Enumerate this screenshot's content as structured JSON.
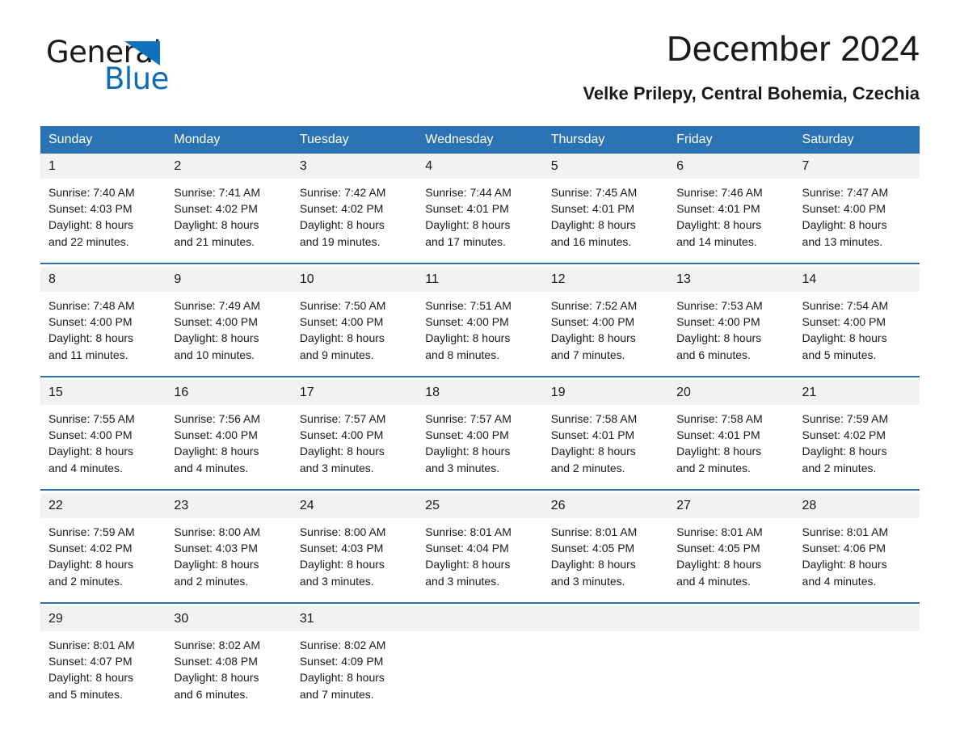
{
  "brand": {
    "name_part1": "General",
    "name_part2": "Blue",
    "triangle_color": "#1072ba",
    "blue_color": "#0d6cb4"
  },
  "header": {
    "title": "December 2024",
    "subtitle": "Velke Prilepy, Central Bohemia, Czechia",
    "accent_color": "#2b72b4",
    "daynum_bg": "#f2f2f2"
  },
  "weekdays": [
    "Sunday",
    "Monday",
    "Tuesday",
    "Wednesday",
    "Thursday",
    "Friday",
    "Saturday"
  ],
  "weeks": [
    [
      {
        "day": "1",
        "sunrise": "Sunrise: 7:40 AM",
        "sunset": "Sunset: 4:03 PM",
        "daylight1": "Daylight: 8 hours",
        "daylight2": "and 22 minutes."
      },
      {
        "day": "2",
        "sunrise": "Sunrise: 7:41 AM",
        "sunset": "Sunset: 4:02 PM",
        "daylight1": "Daylight: 8 hours",
        "daylight2": "and 21 minutes."
      },
      {
        "day": "3",
        "sunrise": "Sunrise: 7:42 AM",
        "sunset": "Sunset: 4:02 PM",
        "daylight1": "Daylight: 8 hours",
        "daylight2": "and 19 minutes."
      },
      {
        "day": "4",
        "sunrise": "Sunrise: 7:44 AM",
        "sunset": "Sunset: 4:01 PM",
        "daylight1": "Daylight: 8 hours",
        "daylight2": "and 17 minutes."
      },
      {
        "day": "5",
        "sunrise": "Sunrise: 7:45 AM",
        "sunset": "Sunset: 4:01 PM",
        "daylight1": "Daylight: 8 hours",
        "daylight2": "and 16 minutes."
      },
      {
        "day": "6",
        "sunrise": "Sunrise: 7:46 AM",
        "sunset": "Sunset: 4:01 PM",
        "daylight1": "Daylight: 8 hours",
        "daylight2": "and 14 minutes."
      },
      {
        "day": "7",
        "sunrise": "Sunrise: 7:47 AM",
        "sunset": "Sunset: 4:00 PM",
        "daylight1": "Daylight: 8 hours",
        "daylight2": "and 13 minutes."
      }
    ],
    [
      {
        "day": "8",
        "sunrise": "Sunrise: 7:48 AM",
        "sunset": "Sunset: 4:00 PM",
        "daylight1": "Daylight: 8 hours",
        "daylight2": "and 11 minutes."
      },
      {
        "day": "9",
        "sunrise": "Sunrise: 7:49 AM",
        "sunset": "Sunset: 4:00 PM",
        "daylight1": "Daylight: 8 hours",
        "daylight2": "and 10 minutes."
      },
      {
        "day": "10",
        "sunrise": "Sunrise: 7:50 AM",
        "sunset": "Sunset: 4:00 PM",
        "daylight1": "Daylight: 8 hours",
        "daylight2": "and 9 minutes."
      },
      {
        "day": "11",
        "sunrise": "Sunrise: 7:51 AM",
        "sunset": "Sunset: 4:00 PM",
        "daylight1": "Daylight: 8 hours",
        "daylight2": "and 8 minutes."
      },
      {
        "day": "12",
        "sunrise": "Sunrise: 7:52 AM",
        "sunset": "Sunset: 4:00 PM",
        "daylight1": "Daylight: 8 hours",
        "daylight2": "and 7 minutes."
      },
      {
        "day": "13",
        "sunrise": "Sunrise: 7:53 AM",
        "sunset": "Sunset: 4:00 PM",
        "daylight1": "Daylight: 8 hours",
        "daylight2": "and 6 minutes."
      },
      {
        "day": "14",
        "sunrise": "Sunrise: 7:54 AM",
        "sunset": "Sunset: 4:00 PM",
        "daylight1": "Daylight: 8 hours",
        "daylight2": "and 5 minutes."
      }
    ],
    [
      {
        "day": "15",
        "sunrise": "Sunrise: 7:55 AM",
        "sunset": "Sunset: 4:00 PM",
        "daylight1": "Daylight: 8 hours",
        "daylight2": "and 4 minutes."
      },
      {
        "day": "16",
        "sunrise": "Sunrise: 7:56 AM",
        "sunset": "Sunset: 4:00 PM",
        "daylight1": "Daylight: 8 hours",
        "daylight2": "and 4 minutes."
      },
      {
        "day": "17",
        "sunrise": "Sunrise: 7:57 AM",
        "sunset": "Sunset: 4:00 PM",
        "daylight1": "Daylight: 8 hours",
        "daylight2": "and 3 minutes."
      },
      {
        "day": "18",
        "sunrise": "Sunrise: 7:57 AM",
        "sunset": "Sunset: 4:00 PM",
        "daylight1": "Daylight: 8 hours",
        "daylight2": "and 3 minutes."
      },
      {
        "day": "19",
        "sunrise": "Sunrise: 7:58 AM",
        "sunset": "Sunset: 4:01 PM",
        "daylight1": "Daylight: 8 hours",
        "daylight2": "and 2 minutes."
      },
      {
        "day": "20",
        "sunrise": "Sunrise: 7:58 AM",
        "sunset": "Sunset: 4:01 PM",
        "daylight1": "Daylight: 8 hours",
        "daylight2": "and 2 minutes."
      },
      {
        "day": "21",
        "sunrise": "Sunrise: 7:59 AM",
        "sunset": "Sunset: 4:02 PM",
        "daylight1": "Daylight: 8 hours",
        "daylight2": "and 2 minutes."
      }
    ],
    [
      {
        "day": "22",
        "sunrise": "Sunrise: 7:59 AM",
        "sunset": "Sunset: 4:02 PM",
        "daylight1": "Daylight: 8 hours",
        "daylight2": "and 2 minutes."
      },
      {
        "day": "23",
        "sunrise": "Sunrise: 8:00 AM",
        "sunset": "Sunset: 4:03 PM",
        "daylight1": "Daylight: 8 hours",
        "daylight2": "and 2 minutes."
      },
      {
        "day": "24",
        "sunrise": "Sunrise: 8:00 AM",
        "sunset": "Sunset: 4:03 PM",
        "daylight1": "Daylight: 8 hours",
        "daylight2": "and 3 minutes."
      },
      {
        "day": "25",
        "sunrise": "Sunrise: 8:01 AM",
        "sunset": "Sunset: 4:04 PM",
        "daylight1": "Daylight: 8 hours",
        "daylight2": "and 3 minutes."
      },
      {
        "day": "26",
        "sunrise": "Sunrise: 8:01 AM",
        "sunset": "Sunset: 4:05 PM",
        "daylight1": "Daylight: 8 hours",
        "daylight2": "and 3 minutes."
      },
      {
        "day": "27",
        "sunrise": "Sunrise: 8:01 AM",
        "sunset": "Sunset: 4:05 PM",
        "daylight1": "Daylight: 8 hours",
        "daylight2": "and 4 minutes."
      },
      {
        "day": "28",
        "sunrise": "Sunrise: 8:01 AM",
        "sunset": "Sunset: 4:06 PM",
        "daylight1": "Daylight: 8 hours",
        "daylight2": "and 4 minutes."
      }
    ],
    [
      {
        "day": "29",
        "sunrise": "Sunrise: 8:01 AM",
        "sunset": "Sunset: 4:07 PM",
        "daylight1": "Daylight: 8 hours",
        "daylight2": "and 5 minutes."
      },
      {
        "day": "30",
        "sunrise": "Sunrise: 8:02 AM",
        "sunset": "Sunset: 4:08 PM",
        "daylight1": "Daylight: 8 hours",
        "daylight2": "and 6 minutes."
      },
      {
        "day": "31",
        "sunrise": "Sunrise: 8:02 AM",
        "sunset": "Sunset: 4:09 PM",
        "daylight1": "Daylight: 8 hours",
        "daylight2": "and 7 minutes."
      },
      {
        "day": "",
        "sunrise": "",
        "sunset": "",
        "daylight1": "",
        "daylight2": ""
      },
      {
        "day": "",
        "sunrise": "",
        "sunset": "",
        "daylight1": "",
        "daylight2": ""
      },
      {
        "day": "",
        "sunrise": "",
        "sunset": "",
        "daylight1": "",
        "daylight2": ""
      },
      {
        "day": "",
        "sunrise": "",
        "sunset": "",
        "daylight1": "",
        "daylight2": ""
      }
    ]
  ]
}
